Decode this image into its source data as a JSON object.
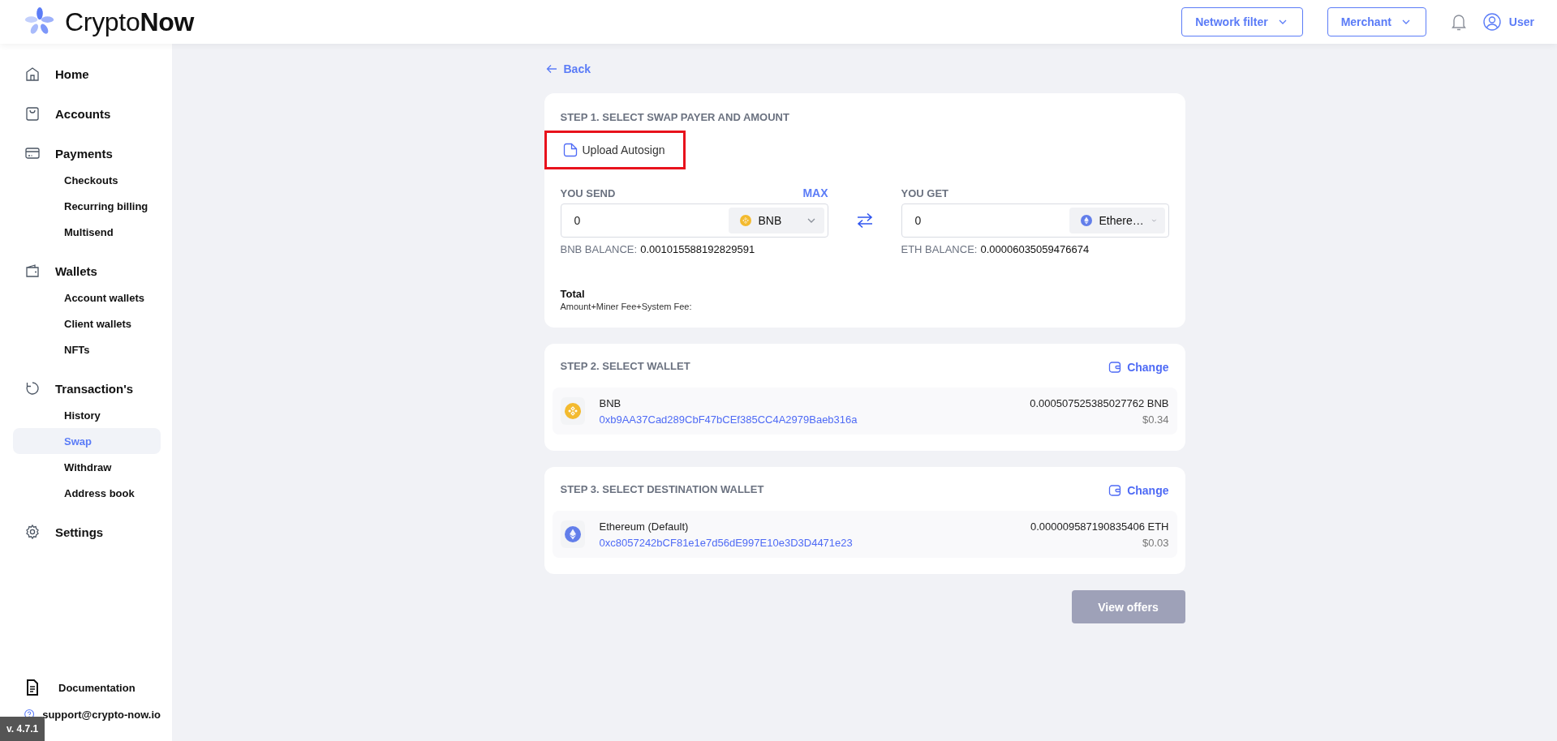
{
  "header": {
    "logo": "Crypto**Now**",
    "network_filter": "Network filter",
    "merchant": "Merchant",
    "user": "User"
  },
  "sidebar": {
    "items": [
      {
        "label": "Home",
        "selected": false
      },
      {
        "label": "Accounts",
        "selected": false
      },
      {
        "label": "Payments",
        "selected": false,
        "children": [
          {
            "label": "Checkouts",
            "selected": false
          },
          {
            "label": "Recurring billing",
            "selected": false
          },
          {
            "label": "Multisend",
            "selected": false
          }
        ]
      },
      {
        "label": "Wallets",
        "selected": false,
        "children": [
          {
            "label": "Account wallets",
            "selected": false
          },
          {
            "label": "Client wallets",
            "selected": false
          },
          {
            "label": "NFTs",
            "selected": false
          }
        ]
      },
      {
        "label": "Transaction's",
        "selected": false,
        "children": [
          {
            "label": "History",
            "selected": false
          },
          {
            "label": "Swap",
            "selected": true
          },
          {
            "label": "Withdraw",
            "selected": false
          },
          {
            "label": "Address book",
            "selected": false
          }
        ]
      },
      {
        "label": "Settings",
        "selected": false
      }
    ],
    "documentation": "Documentation",
    "support": "support@crypto-now.io"
  },
  "version": "v. 4.7.1",
  "back": "Back",
  "step1": {
    "title": "STEP 1. SELECT SWAP PAYER AND AMOUNT",
    "upload": {
      "label": "Upload Autosign",
      "highlighted": true
    },
    "send": {
      "label": "YOU SEND",
      "max": "MAX",
      "value": "0",
      "token": "BNB",
      "kind": "bnb",
      "balance_label": "BNB BALANCE:",
      "balance": "0.001015588192829591"
    },
    "get": {
      "label": "YOU GET",
      "value": "0",
      "token": "Ethere…",
      "kind": "eth",
      "balance_label": "ETH BALANCE:",
      "balance": "0.00006035059476674"
    },
    "total": "Total",
    "total_note": "Amount+Miner Fee+System Fee:"
  },
  "steps": [
    {
      "title": "STEP 2. SELECT WALLET",
      "change": "Change",
      "wallet": {
        "kind": "bnb",
        "name": "BNB",
        "address": "0xb9AA37Cad289CbF47bCEf385CC4A2979Baeb316a",
        "amount": "0.000507525385027762 BNB",
        "usd": "$0.34"
      }
    },
    {
      "title": "STEP 3. SELECT DESTINATION WALLET",
      "change": "Change",
      "wallet": {
        "kind": "eth",
        "name": "Ethereum (Default)",
        "address": "0xc8057242bCF81e1e7d56dE997E10e3D3D4471e23",
        "amount": "0.000009587190835406 ETH",
        "usd": "$0.03"
      }
    }
  ],
  "view_offers": {
    "label": "View offers",
    "disabled": true
  }
}
